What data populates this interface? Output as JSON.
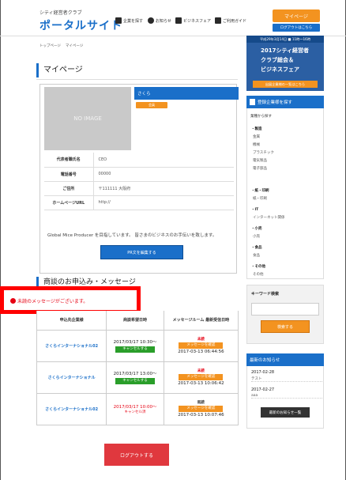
{
  "header": {
    "brand_sub": "シティ経営者クラブ",
    "brand_title": "ポータルサイト",
    "nav": [
      "企業を探す",
      "お知らせ",
      "ビジネスフェア",
      "ご利用ガイド"
    ],
    "mypage_button": "マイページ",
    "login_info_button": "ログアウトはこちら"
  },
  "breadcrumb": [
    "トップページ",
    "マイページ"
  ],
  "page_title": "マイページ",
  "profile": {
    "noimage": "NO IMAGE",
    "company_name": "さくら",
    "badge": "会員",
    "rows": [
      {
        "label": "代表者職氏名",
        "value": "CEO"
      },
      {
        "label": "電話番号",
        "value": "00000"
      },
      {
        "label": "ご住所",
        "value": "〒111111 大阪府"
      },
      {
        "label": "ホームページURL",
        "value": "http://"
      }
    ],
    "description": "Global Mice Producer を目指しています。 皆さまのビジネスのお手伝いを致します。",
    "edit_button": "PR文を編集する"
  },
  "messages": {
    "title": "商談のお申込み・メッセージ",
    "alert": "未読のメッセージがございます。",
    "headers": [
      "申込先企業様",
      "商談希望日時",
      "メッセージルーム 最新受信日時"
    ],
    "rows": [
      {
        "partner": "さくらインターナショナル02",
        "datetime": "2017/03/17 10:30〜",
        "action": "キャンセルする",
        "status": "未読",
        "msg_button": "メッセージを確認",
        "received": "2017-03-13 06:44:56"
      },
      {
        "partner": "さくらインターナショナル",
        "datetime": "2017/03/17 13:00〜",
        "action": "キャンセルする",
        "status": "未読",
        "msg_button": "メッセージを確認",
        "received": "2017-03-13 10:06:42"
      },
      {
        "partner": "さくらインターナショナル02",
        "datetime": "2017/03/17 10:00〜",
        "action": "キャンセル済",
        "status": "既読",
        "msg_button": "メッセージを確認",
        "received": "2017-03-13 10:07:46"
      }
    ],
    "logout_button": "ログアウトする"
  },
  "sidebar": {
    "banner_top": "平成29年3月14日 ■ 11時〜16時",
    "banner_lines": [
      "2017シティ経営者",
      "クラブ総会＆",
      "ビジネスフェア"
    ],
    "banner_cta": "出展企業様の一覧はこちら",
    "search_title": "登録企業様を探す",
    "search_sub": "業種から探す",
    "categories": [
      {
        "head": "・製造",
        "items": [
          "金属",
          "機械",
          "プラスチック",
          "電気製品",
          "電子部品"
        ]
      },
      {
        "head": "・紙・印刷",
        "items": [
          "紙・印刷"
        ]
      },
      {
        "head": "・IT",
        "items": [
          "インターネット関係"
        ]
      },
      {
        "head": "・小売",
        "items": [
          "小売"
        ]
      },
      {
        "head": "・食品",
        "items": [
          "食品"
        ]
      },
      {
        "head": "・その他",
        "items": [
          "その他"
        ]
      }
    ],
    "keyword_title": "キーワード検索",
    "keyword_button": "検索する",
    "news_title": "最新のお知らせ",
    "news": [
      {
        "date": "2017-02-28",
        "text": "テスト"
      },
      {
        "date": "2017-02-27",
        "text": "aaa"
      }
    ],
    "news_button": "最新のお知らせ一覧"
  }
}
